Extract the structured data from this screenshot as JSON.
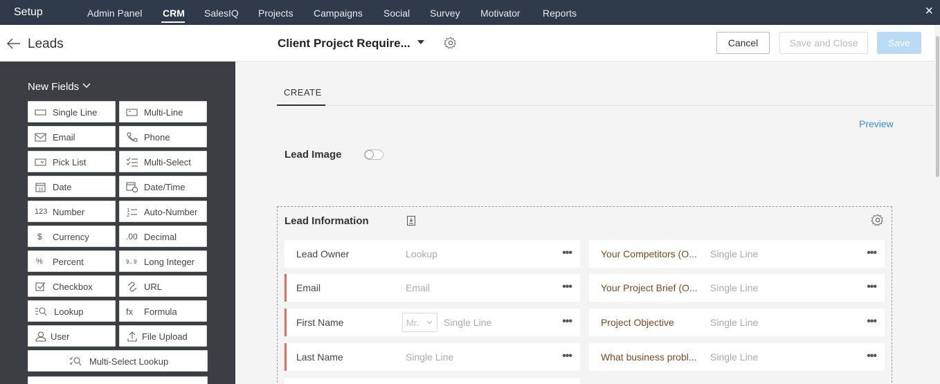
{
  "topnav": {
    "setup": "Setup",
    "items": [
      "Admin Panel",
      "CRM",
      "SalesIQ",
      "Projects",
      "Campaigns",
      "Social",
      "Survey",
      "Motivator",
      "Reports"
    ],
    "active": "CRM",
    "close_icon": "×"
  },
  "header": {
    "module": "Leads",
    "layout_name": "Client Project Require...",
    "cancel": "Cancel",
    "save_and_close": "Save and Close",
    "save": "Save"
  },
  "sidebar": {
    "title": "New Fields",
    "fields": [
      {
        "label": "Single Line",
        "icon": "single-line-icon"
      },
      {
        "label": "Multi-Line",
        "icon": "multi-line-icon"
      },
      {
        "label": "Email",
        "icon": "email-icon"
      },
      {
        "label": "Phone",
        "icon": "phone-icon"
      },
      {
        "label": "Pick List",
        "icon": "pick-list-icon"
      },
      {
        "label": "Multi-Select",
        "icon": "multi-select-icon"
      },
      {
        "label": "Date",
        "icon": "date-icon"
      },
      {
        "label": "Date/Time",
        "icon": "date-time-icon"
      },
      {
        "label": "Number",
        "icon": "number-icon",
        "glyph": "123"
      },
      {
        "label": "Auto-Number",
        "icon": "auto-number-icon"
      },
      {
        "label": "Currency",
        "icon": "currency-icon",
        "glyph": "$"
      },
      {
        "label": "Decimal",
        "icon": "decimal-icon",
        "glyph": ".00"
      },
      {
        "label": "Percent",
        "icon": "percent-icon",
        "glyph": "%"
      },
      {
        "label": "Long Integer",
        "icon": "long-integer-icon",
        "glyph": "9...9"
      },
      {
        "label": "Checkbox",
        "icon": "checkbox-icon"
      },
      {
        "label": "URL",
        "icon": "url-icon"
      },
      {
        "label": "Lookup",
        "icon": "lookup-icon"
      },
      {
        "label": "Formula",
        "icon": "formula-icon",
        "glyph": "fx"
      },
      {
        "label": "User",
        "icon": "user-icon"
      },
      {
        "label": "File Upload",
        "icon": "file-upload-icon"
      }
    ],
    "wide_fields": [
      {
        "label": "Multi-Select Lookup",
        "icon": "multi-select-lookup-icon"
      }
    ]
  },
  "main": {
    "tab": "CREATE",
    "preview": "Preview",
    "lead_image_label": "Lead Image",
    "lead_image_enabled": false,
    "section": {
      "title": "Lead Information",
      "left_rows": [
        {
          "label": "Lead Owner",
          "type": "Lookup",
          "mandatory": false
        },
        {
          "label": "Email",
          "type": "Email",
          "mandatory": true
        },
        {
          "label": "First Name",
          "type": "Single Line",
          "mandatory": true,
          "salutation": "Mr."
        },
        {
          "label": "Last Name",
          "type": "Single Line",
          "mandatory": true
        }
      ],
      "right_rows": [
        {
          "label": "Your Competitors (O...",
          "type": "Single Line"
        },
        {
          "label": "Your Project Brief (O...",
          "type": "Single Line"
        },
        {
          "label": "Project Objective",
          "type": "Single Line"
        },
        {
          "label": "What business probl...",
          "type": "Single Line"
        }
      ],
      "more_icon": "•••"
    }
  },
  "colors": {
    "topnav_bg": "#2f3a4a",
    "sidebar_bg": "#3b3f44",
    "mandatory_bar": "#e06c5e",
    "link": "#3d8fd6",
    "save_disabled": "#b9dbf5"
  }
}
